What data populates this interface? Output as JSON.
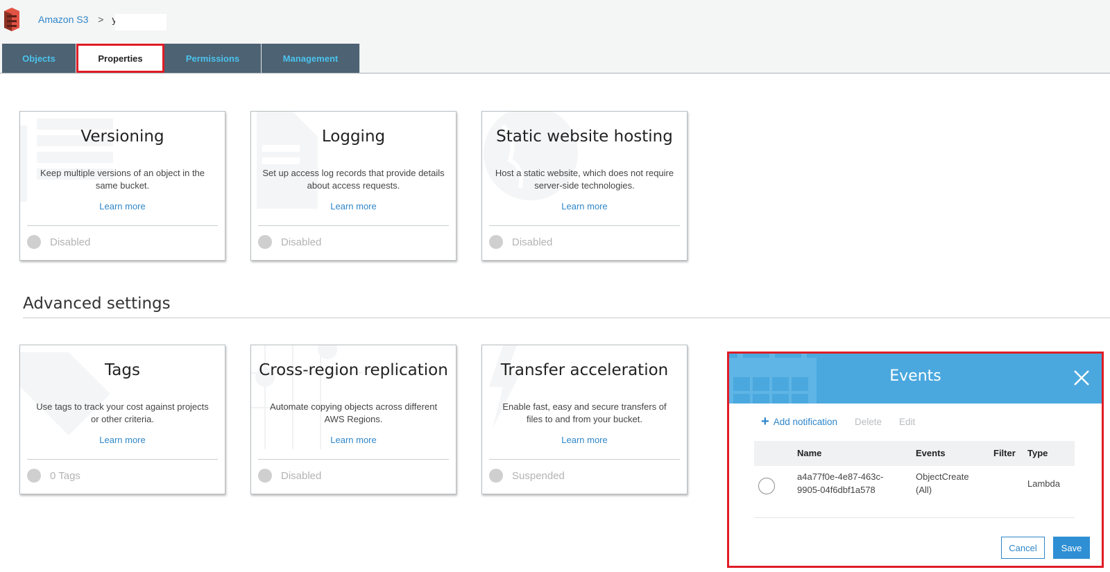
{
  "breadcrumb": {
    "service": "Amazon S3",
    "separator": ">",
    "bucket": "y"
  },
  "tabs": [
    {
      "label": "Objects",
      "active": false
    },
    {
      "label": "Properties",
      "active": true
    },
    {
      "label": "Permissions",
      "active": false
    },
    {
      "label": "Management",
      "active": false
    }
  ],
  "properties_cards": [
    {
      "title": "Versioning",
      "description": "Keep multiple versions of an object in the same bucket.",
      "link": "Learn more",
      "status": "Disabled",
      "icon": "versioning-watermark-icon"
    },
    {
      "title": "Logging",
      "description": "Set up access log records that provide details about access requests.",
      "link": "Learn more",
      "status": "Disabled",
      "icon": "logging-document-icon"
    },
    {
      "title": "Static website hosting",
      "description": "Host a static website, which does not require server-side technologies.",
      "link": "Learn more",
      "status": "Disabled",
      "icon": "globe-icon"
    }
  ],
  "advanced_settings": {
    "title": "Advanced settings",
    "cards": [
      {
        "title": "Tags",
        "description": "Use tags to track your cost against projects or other criteria.",
        "link": "Learn more",
        "status": "0 Tags",
        "icon": "tag-icon"
      },
      {
        "title": "Cross-region replication",
        "description": "Automate copying objects across different AWS Regions.",
        "link": "Learn more",
        "status": "Disabled",
        "icon": "map-pin-icon"
      },
      {
        "title": "Transfer acceleration",
        "description": "Enable fast, easy and secure transfers of files to and from your bucket.",
        "link": "Learn more",
        "status": "Suspended",
        "icon": "lightning-icon"
      }
    ]
  },
  "events_panel": {
    "title": "Events",
    "toolbar": {
      "add": "Add notification",
      "delete": "Delete",
      "edit": "Edit"
    },
    "columns": [
      "Name",
      "Events",
      "Filter",
      "Type"
    ],
    "rows": [
      {
        "name_line1": "a4a77f0e-4e87-463c-",
        "name_line2": "9905-04f6dbf1a578",
        "events_line1": "ObjectCreate",
        "events_line2": "(All)",
        "filter": "",
        "type": "Lambda",
        "selected": false
      }
    ],
    "cancel_label": "Cancel",
    "save_label": "Save"
  },
  "colors": {
    "tab_bg": "#4d6272",
    "tab_text": "#4bc3ee",
    "highlight_red": "#e01c25",
    "events_header": "#4aa8de",
    "link_blue": "#2e86c9",
    "status_grey": "#cfcfcf"
  }
}
